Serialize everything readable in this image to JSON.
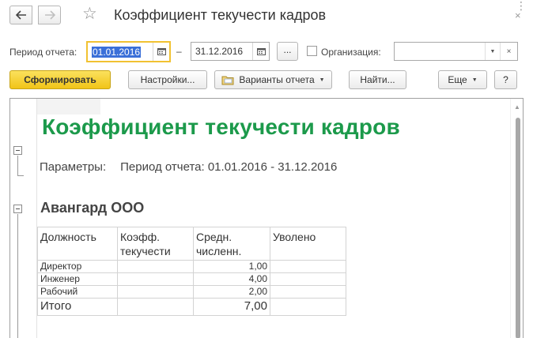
{
  "window": {
    "title": "Коэффициент текучести кадров",
    "back_icon": "arrow-left-icon",
    "forward_icon": "arrow-right-icon",
    "favorite_icon": "star-icon",
    "menu_icon": "more-dots-icon",
    "close_glyph": "×"
  },
  "period": {
    "label": "Период отчета:",
    "from": "01.01.2016",
    "separator": "–",
    "to": "31.12.2016",
    "select_button": "...",
    "org_checkbox_checked": false,
    "org_label": "Организация:",
    "org_value": "",
    "org_dropdown_glyph": "▼",
    "org_clear_glyph": "×"
  },
  "toolbar": {
    "generate": "Сформировать",
    "settings": "Настройки...",
    "variants": "Варианты отчета",
    "find": "Найти...",
    "more": "Еще",
    "help": "?"
  },
  "report": {
    "title": "Коэффициент текучести кадров",
    "params_label": "Параметры:",
    "params_value": "Период отчета: 01.01.2016 - 31.12.2016",
    "organization": "Авангард ООО",
    "columns": [
      "Должность",
      "Коэфф. текучести",
      "Средн. численн.",
      "Уволено"
    ],
    "rows": [
      {
        "position": "Директор",
        "coef": "",
        "avg": "1,00",
        "fired": ""
      },
      {
        "position": "Инженер",
        "coef": "",
        "avg": "4,00",
        "fired": ""
      },
      {
        "position": "Рабочий",
        "coef": "",
        "avg": "2,00",
        "fired": ""
      }
    ],
    "total": {
      "position": "Итого",
      "coef": "",
      "avg": "7,00",
      "fired": ""
    }
  },
  "colors": {
    "accent_yellow": "#f1c418",
    "title_green": "#1c9a4b",
    "selection_blue": "#3a6fd8"
  }
}
